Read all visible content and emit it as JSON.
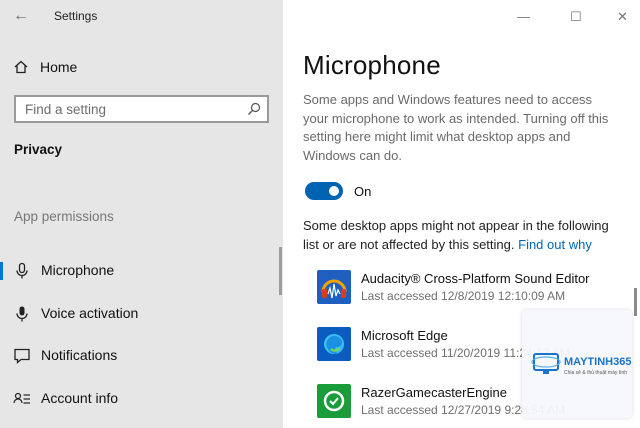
{
  "window": {
    "title": "Settings",
    "controls": {
      "minimize": "—",
      "maximize": "☐",
      "close": "✕"
    }
  },
  "sidebar": {
    "home_label": "Home",
    "search_placeholder": "Find a setting",
    "section_title": "Privacy",
    "group_title": "App permissions",
    "items": [
      {
        "label": "Microphone",
        "icon": "microphone-icon",
        "selected": true
      },
      {
        "label": "Voice activation",
        "icon": "voice-activation-icon",
        "selected": false
      },
      {
        "label": "Notifications",
        "icon": "notifications-icon",
        "selected": false
      },
      {
        "label": "Account info",
        "icon": "account-info-icon",
        "selected": false
      }
    ]
  },
  "main": {
    "title": "Microphone",
    "description": "Some apps and Windows features need to access your microphone to work as intended. Turning off this setting here might limit what desktop apps and Windows can do.",
    "toggle": {
      "label": "On",
      "state": true
    },
    "note": "Some desktop apps might not appear in the following list or are not affected by this setting.",
    "note_link": "Find out why",
    "apps": [
      {
        "name": "Audacity® Cross-Platform Sound Editor",
        "last_accessed": "Last accessed 12/8/2019 12:10:09 AM",
        "icon": "audacity-icon"
      },
      {
        "name": "Microsoft Edge",
        "last_accessed": "Last accessed 11/20/2019 11:24:13 AM",
        "icon": "edge-icon"
      },
      {
        "name": "RazerGamecasterEngine",
        "last_accessed": "Last accessed 12/27/2019 9:28:54 AM",
        "icon": "razer-icon"
      }
    ]
  },
  "watermark": {
    "brand": "MAYTINH365",
    "tagline": "Chia sẻ & thủ thuật máy tính"
  },
  "colors": {
    "accent": "#0063b1",
    "link": "#0066b4",
    "sidebar_bg": "#e6e6e6"
  }
}
